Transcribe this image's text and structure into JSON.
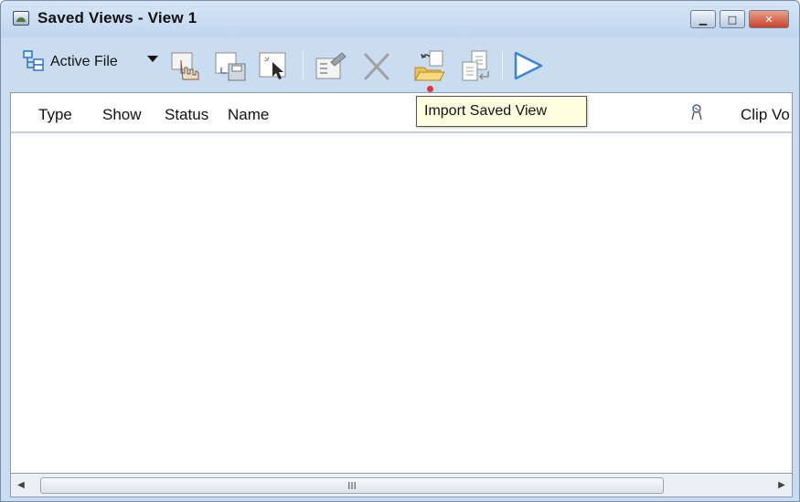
{
  "window": {
    "title": "Saved Views - View 1",
    "controls": {
      "minimize": "▁",
      "maximize": "□",
      "close": "✕"
    }
  },
  "toolbar": {
    "scope_label": "Active File",
    "buttons": [
      {
        "name": "create-view-button",
        "icon": "hand-pointer-icon"
      },
      {
        "name": "save-view-button",
        "icon": "floppy-save-icon"
      },
      {
        "name": "select-view-button",
        "icon": "cursor-select-icon"
      },
      {
        "name": "properties-button",
        "icon": "properties-icon"
      },
      {
        "name": "delete-button",
        "icon": "delete-x-icon"
      },
      {
        "name": "import-saved-view-button",
        "icon": "folder-import-icon"
      },
      {
        "name": "export-button",
        "icon": "document-export-icon"
      },
      {
        "name": "filter-button",
        "icon": "funnel-icon"
      }
    ]
  },
  "list": {
    "columns": [
      "Type",
      "Show",
      "Status",
      "Name",
      "Clip Vo"
    ],
    "rows": []
  },
  "tooltip": {
    "text": "Import Saved View"
  },
  "scrollbar": {
    "thumb_grip": "III"
  },
  "colors": {
    "titlebar": "#c9dcf0",
    "close_button": "#c8432b",
    "tooltip_bg": "#ffffe1"
  }
}
